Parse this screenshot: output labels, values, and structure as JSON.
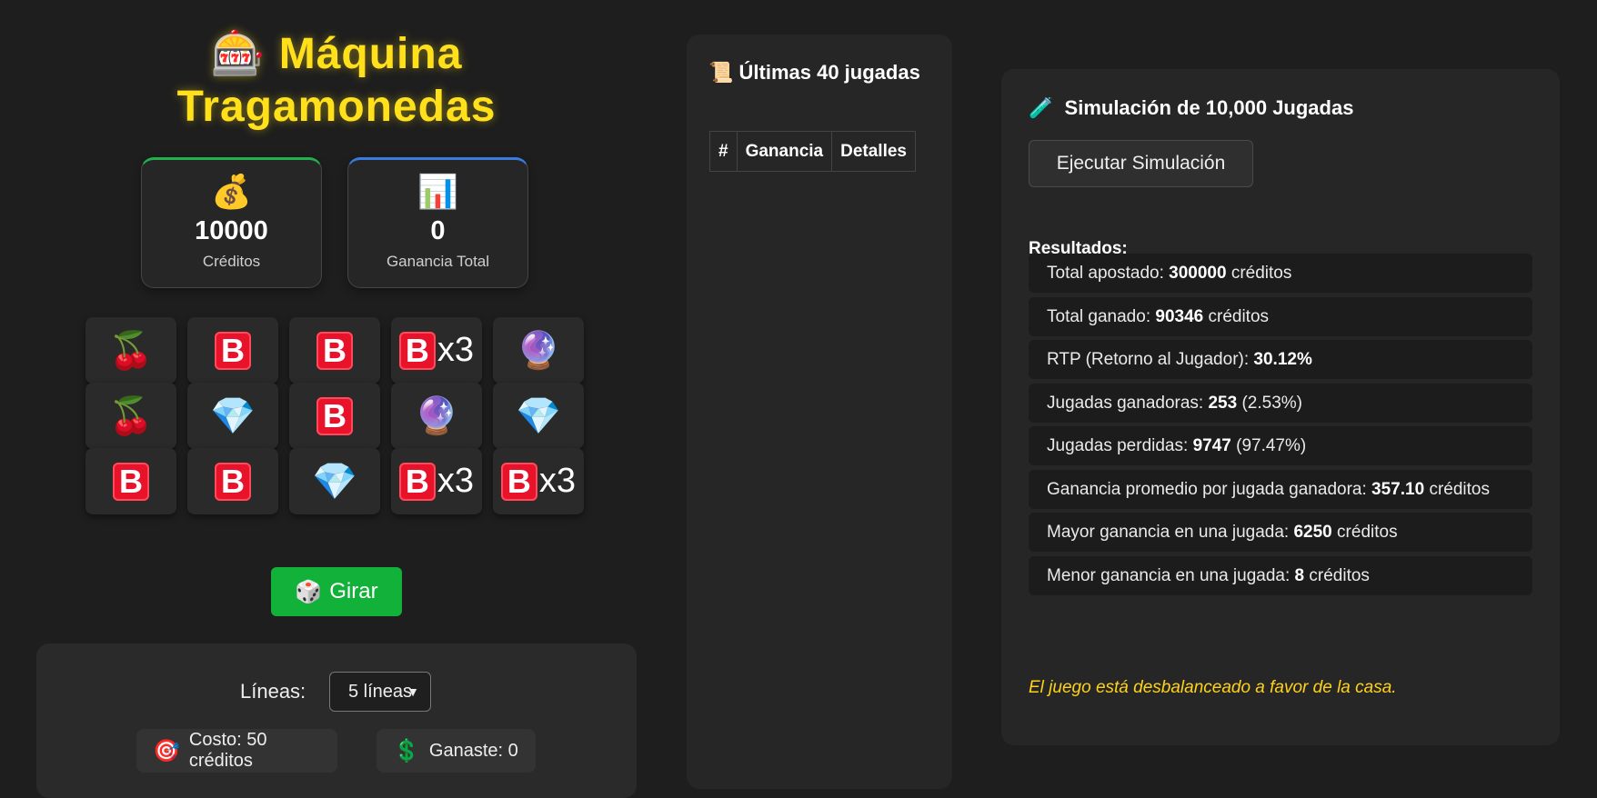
{
  "title": {
    "icon": "🎰",
    "text_line1": "Máquina",
    "text_line2": "Tragamonedas"
  },
  "stats": {
    "credits": {
      "icon": "💰",
      "value": "10000",
      "label": "Créditos"
    },
    "total_win": {
      "icon": "📊",
      "value": "0",
      "label": "Ganancia Total"
    }
  },
  "reels": [
    [
      "🍒",
      "B",
      "B",
      "Bx3",
      "🔮"
    ],
    [
      "🍒",
      "💎",
      "B",
      "🔮",
      "💎"
    ],
    [
      "B",
      "B",
      "💎",
      "Bx3",
      "Bx3"
    ]
  ],
  "reel_b_letter": "B",
  "reel_multiplier": "x3",
  "spin_button": {
    "icon": "🎲",
    "label": "Girar"
  },
  "controls": {
    "lines_label": "Líneas:",
    "lines_selected": "5 líneas",
    "caret": "▼",
    "cost": {
      "icon": "🎯",
      "text": "Costo: 50 créditos"
    },
    "won": {
      "icon": "💲",
      "text": "Ganaste: 0"
    }
  },
  "history": {
    "title": "📜 Últimas 40 jugadas",
    "columns": [
      "#",
      "Ganancia",
      "Detalles"
    ]
  },
  "simulation": {
    "title_icon": "🧪",
    "title": "Simulación de 10,000 Jugadas",
    "run_button": "Ejecutar Simulación",
    "results_title": "Resultados:",
    "rows": [
      {
        "label": "Total apostado:",
        "value": "300000",
        "suffix": "créditos"
      },
      {
        "label": "Total ganado:",
        "value": "90346",
        "suffix": "créditos"
      },
      {
        "label": "RTP (Retorno al Jugador):",
        "value": "30.12%",
        "suffix": ""
      },
      {
        "label": "Jugadas ganadoras:",
        "value": "253",
        "suffix": "(2.53%)"
      },
      {
        "label": "Jugadas perdidas:",
        "value": "9747",
        "suffix": "(97.47%)"
      },
      {
        "label": "Ganancia promedio por jugada ganadora:",
        "value": "357.10",
        "suffix": "créditos"
      },
      {
        "label": "Mayor ganancia en una jugada:",
        "value": "6250",
        "suffix": "créditos"
      },
      {
        "label": "Menor ganancia en una jugada:",
        "value": "8",
        "suffix": "créditos"
      }
    ],
    "verdict": "El juego está desbalanceado a favor de la casa."
  },
  "colors": {
    "accent_yellow": "#ffe01a",
    "spin_green": "#12b13a",
    "credits_border": "#22b14c",
    "total_border": "#3a7be0",
    "badge_red": "#e8132b"
  }
}
